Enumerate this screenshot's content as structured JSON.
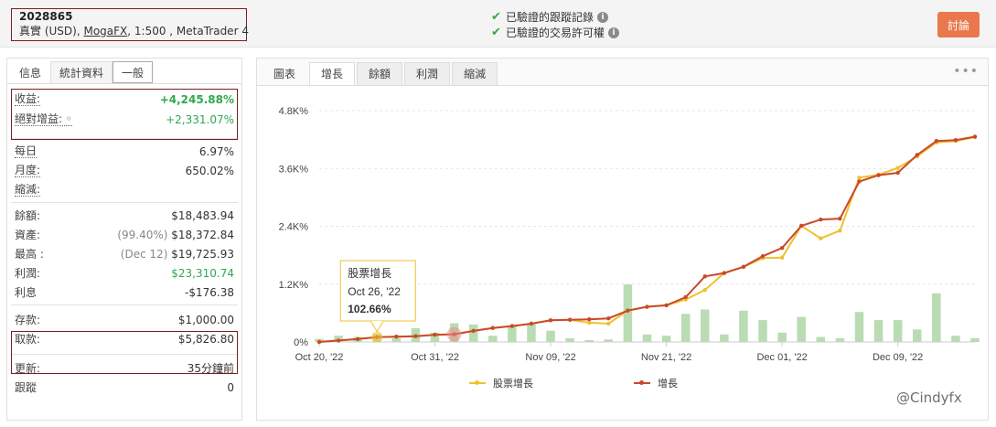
{
  "account": {
    "id": "2028865",
    "type": "真實 (USD),",
    "broker": "MogaFX",
    "rest": ", 1:500 , MetaTrader 4"
  },
  "verification": {
    "track_record": "已驗證的跟蹤記錄",
    "trading_permission": "已驗證的交易許可權",
    "info_glyph": "i"
  },
  "discuss_label": "討論",
  "left_tabs": [
    "信息",
    "統計資料",
    "一般"
  ],
  "stats": {
    "gain_label": "收益:",
    "gain_value": "+4,245.88%",
    "abs_gain_label": "絕對增益: ◦",
    "abs_gain_value": "+2,331.07%",
    "daily_label": "每日",
    "daily_value": "6.97%",
    "monthly_label": "月度:",
    "monthly_value": "650.02%",
    "drawdown_label": "縮減:",
    "balance_label": "餘額:",
    "balance_value": "$18,483.94",
    "equity_label": "資產:",
    "equity_pct": "(99.40%)",
    "equity_value": "$18,372.84",
    "highest_label": "最高 :",
    "highest_date": "(Dec 12)",
    "highest_value": "$19,725.93",
    "profit_label": "利潤:",
    "profit_value": "$23,310.74",
    "interest_label": "利息",
    "interest_value": "-$176.38",
    "deposits_label": "存款:",
    "deposits_value": "$1,000.00",
    "withdrawals_label": "取款:",
    "withdrawals_value": "$5,826.80",
    "updated_label": "更新:",
    "updated_value": "35分鐘前",
    "tracking_label": "跟蹤",
    "tracking_value": "0"
  },
  "right_tabs": [
    "圖表",
    "增長",
    "餘額",
    "利潤",
    "縮減"
  ],
  "more_glyph": "•••",
  "tooltip": {
    "title": "股票增長",
    "date": "Oct 26, '22",
    "value": "102.66%"
  },
  "watermark": "@Cindyfx",
  "colors": {
    "equity_line": "#f0c030",
    "growth_line": "#c84a2a",
    "bars": "#b9dcb3",
    "accent": "#e9784c"
  },
  "chart_data": {
    "type": "line",
    "title": "",
    "xlabel": "",
    "ylabel": "",
    "y_tick_labels": [
      "0%",
      "1.2K%",
      "2.4K%",
      "3.6K%",
      "4.8K%"
    ],
    "ylim": [
      0,
      4800
    ],
    "x_tick_labels": [
      "Oct 20, '22",
      "Oct 31, '22",
      "Nov 09, '22",
      "Nov 21, '22",
      "Dec 01, '22",
      "Dec 09, '22"
    ],
    "x_tick_index": [
      0,
      6,
      12,
      18,
      24,
      30
    ],
    "legend": [
      "股票增長",
      "增長"
    ],
    "legend_position": "bottom",
    "grid": true,
    "series": [
      {
        "name": "增長",
        "values": [
          0,
          30,
          60,
          100,
          110,
          120,
          150,
          160,
          230,
          290,
          330,
          380,
          450,
          460,
          470,
          490,
          650,
          730,
          760,
          930,
          1360,
          1430,
          1560,
          1780,
          1950,
          2410,
          2540,
          2560,
          3330,
          3460,
          3510,
          3880,
          4170,
          4190,
          4260
        ]
      },
      {
        "name": "股票增長",
        "values": [
          0,
          30,
          60,
          103,
          110,
          120,
          150,
          160,
          230,
          290,
          330,
          380,
          450,
          460,
          400,
          380,
          650,
          730,
          760,
          880,
          1080,
          1430,
          1560,
          1740,
          1750,
          2410,
          2150,
          2310,
          3410,
          3470,
          3610,
          3850,
          4140,
          4170,
          4250
        ]
      }
    ],
    "bars_name": "",
    "bars": [
      5,
      10,
      8,
      12,
      6,
      22,
      15,
      30,
      28,
      10,
      25,
      30,
      18,
      6,
      3,
      4,
      92,
      12,
      10,
      45,
      52,
      12,
      50,
      35,
      15,
      40,
      8,
      6,
      48,
      35,
      35,
      20,
      78,
      10,
      6
    ]
  }
}
